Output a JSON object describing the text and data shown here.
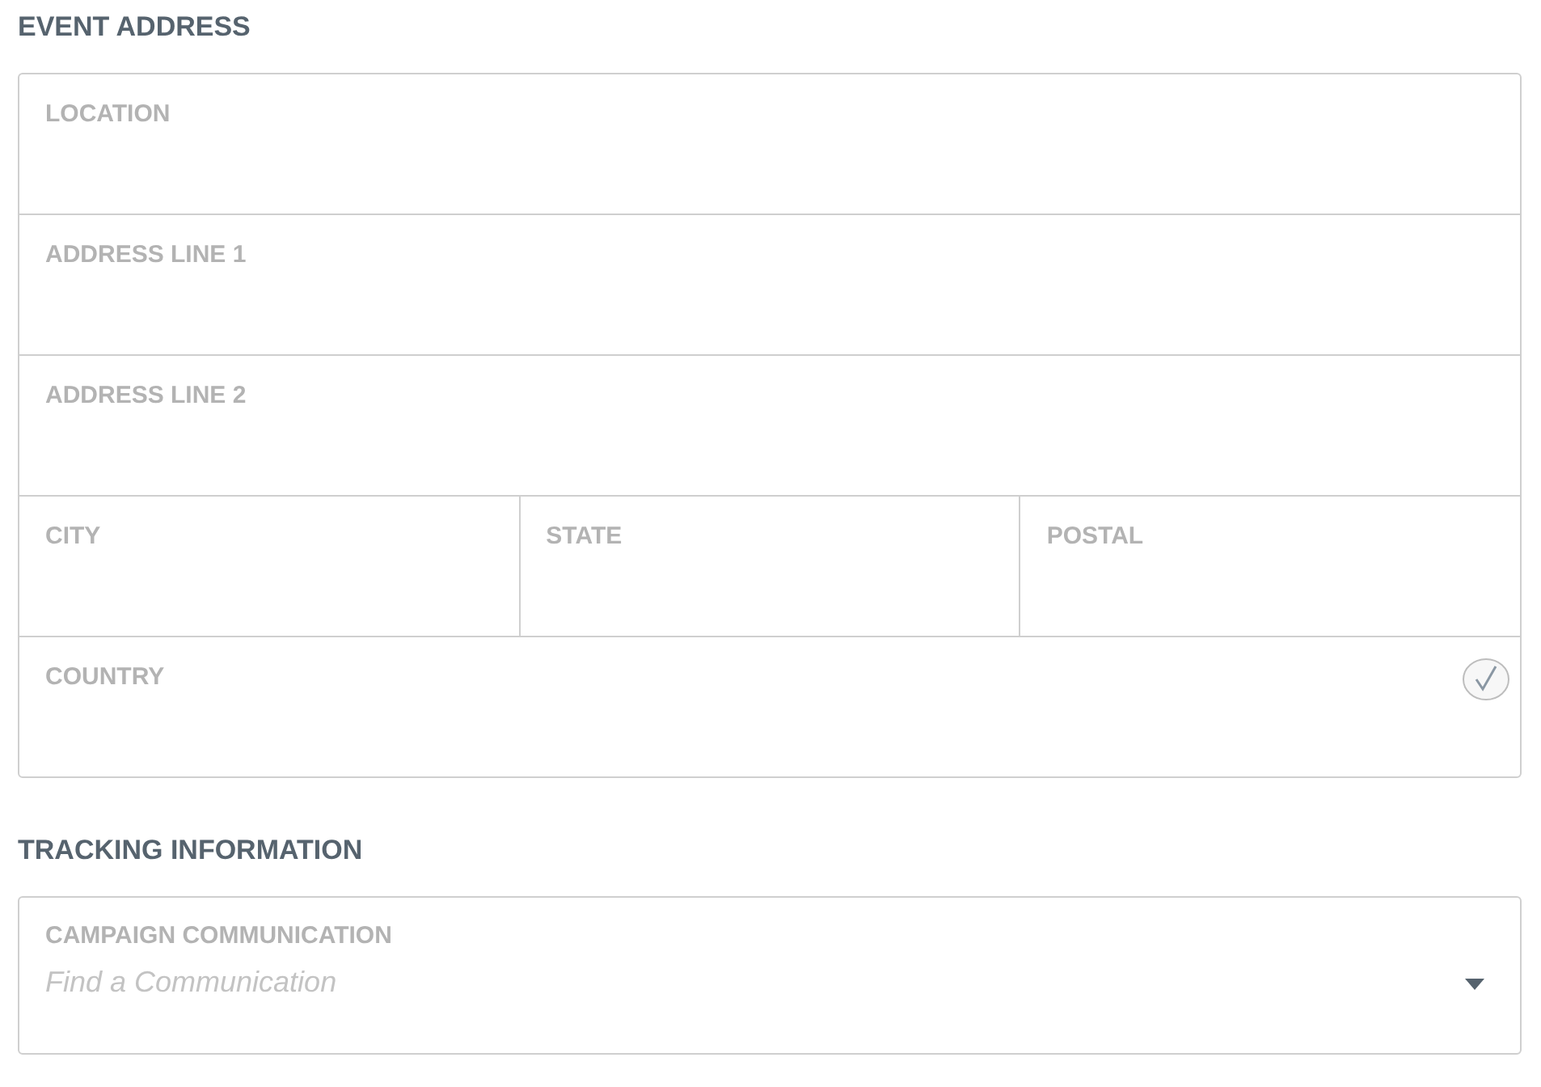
{
  "event_address": {
    "title": "EVENT ADDRESS",
    "rows": [
      [
        {
          "label": "LOCATION",
          "validated": false
        }
      ],
      [
        {
          "label": "ADDRESS LINE 1",
          "validated": false
        }
      ],
      [
        {
          "label": "ADDRESS LINE 2",
          "validated": false
        }
      ],
      [
        {
          "label": "CITY",
          "validated": false
        },
        {
          "label": "STATE",
          "validated": false
        },
        {
          "label": "POSTAL",
          "validated": false
        }
      ],
      [
        {
          "label": "COUNTRY",
          "validated": true
        }
      ]
    ]
  },
  "tracking_information": {
    "title": "TRACKING INFORMATION",
    "field": {
      "label": "CAMPAIGN COMMUNICATION",
      "placeholder": "Find a Communication"
    }
  }
}
